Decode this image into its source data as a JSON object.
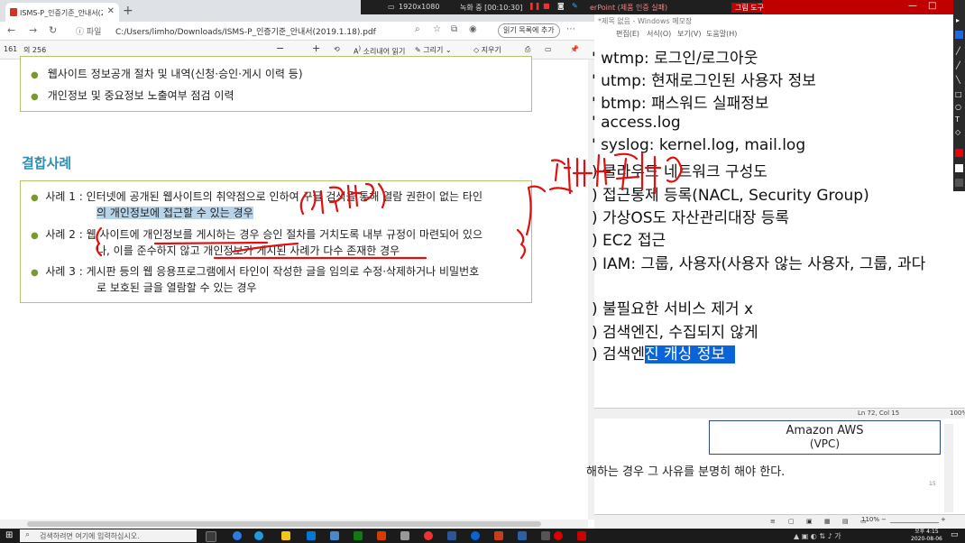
{
  "browser": {
    "tab_title": "ISMS-P_인증기준_안내서(2019.1",
    "address_prefix": "파일",
    "url": "C:/Users/limho/Downloads/ISMS-P_인증기준_안내서(2019.1.18).pdf",
    "read_later": "읽기 목록에 추가",
    "pdf": {
      "page_number": "161",
      "page_total": "의 256",
      "zoom_minus": "−",
      "zoom_plus": "+",
      "read_aloud": "소리내어 읽기",
      "draw": "그리기",
      "erase": "지우기"
    }
  },
  "doc": {
    "bullets_top": [
      "웹사이트 정보공개 절차 및 내역(신청·승인·게시 이력 등)",
      "개인정보 및 중요정보 노출여부 점검 이력"
    ],
    "section_title": "결합사례",
    "cases": [
      {
        "label": "사례 1 :",
        "line1": "인터넷에 공개된 웹사이트의 취약점으로 인하여 구글 검색을 통해 열람 권한이 없는 타인",
        "line2": "의 개인정보에 접근할 수 있는 경우"
      },
      {
        "label": "사례 2 :",
        "line1": "웹 사이트에 개인정보를 게시하는 경우 승인 절차를 거치도록 내부 규정이 마련되어 있으",
        "line2": "나, 이를 준수하지 않고 개인정보가 게시된 사례가 다수 존재한 경우"
      },
      {
        "label": "사례 3 :",
        "line1": "게시판 등의 웹 응용프로그램에서 타인이 작성한 글을 임의로 수정·삭제하거나 비밀번호",
        "line2": "로 보호된 글을 열람할 수 있는 경우"
      }
    ],
    "annotation_1": "(서버)",
    "annotation_2": "잘되어있다"
  },
  "recorder": {
    "resolution": "1920x1080",
    "recording": "녹화 중 [00:10:30]",
    "draw_tools": "그림 도구",
    "ppt_title": "erPoint (제품 인증 실패)"
  },
  "notepad": {
    "title": "*제목 없음 - Windows 메모장",
    "menu": [
      "편집(E)",
      "서식(O)",
      "보기(V)",
      "도움말(H)"
    ],
    "lines": [
      "' wtmp: 로그인/로그아웃",
      "' utmp: 현재로그인된 사용자 정보",
      "' btmp: 패스워드 실패정보",
      "' access.log",
      "' syslog: kernel.log, mail.log",
      ") 클라우드 네트워크 구성도",
      ") 접근통제 등록(NACL, Security Group)",
      ") 가상OS도 자산관리대장 등록",
      ") EC2 접근",
      ") IAM: 그룹, 사용자(사용자 않는 사용자, 그룹, 과다",
      "",
      ") 불필요한 서비스 제거   x",
      ") 검색엔진, 수집되지 않게",
      ") 검색엔"
    ],
    "selected_text": "진 캐싱 정보",
    "status_position": "Ln 72, Col 15",
    "status_zoom": "100%"
  },
  "ppt": {
    "aws_line1": "Amazon AWS",
    "aws_line2": "(VPC)",
    "bottom_text": "해하는 경우 그 사유를 분명히 해야 한다.",
    "page_num": "15",
    "zoom": "110%"
  },
  "taskbar": {
    "search_placeholder": "검색하려면 여기에 입력하십시오.",
    "time": "오후 4:15",
    "date": "2020-08-06"
  }
}
